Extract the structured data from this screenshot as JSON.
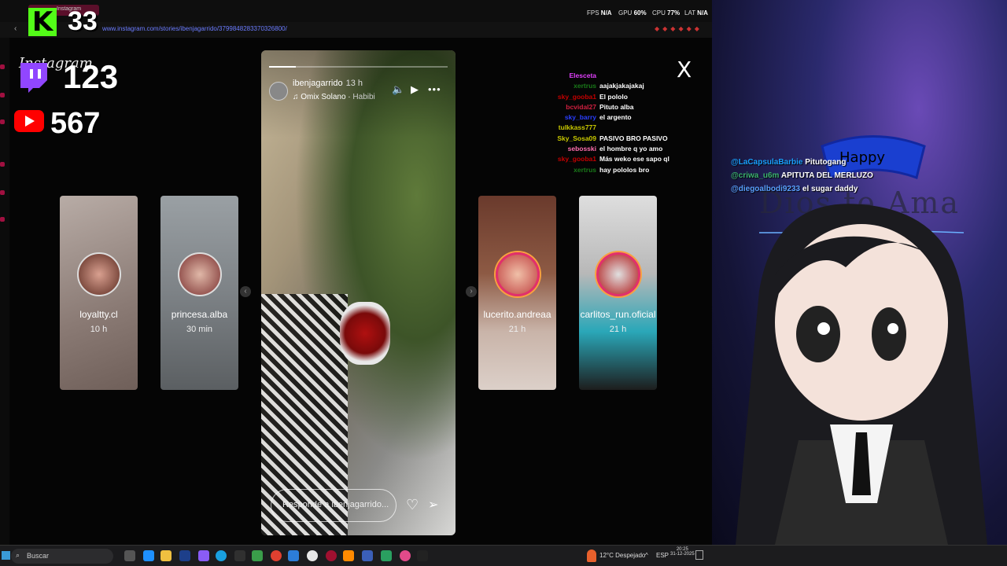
{
  "browser": {
    "tab_title": "Instagram",
    "url": "www.instagram.com/stories/ibenjagarrido/3799848283370326800/",
    "perf": {
      "fps_label": "FPS",
      "fps": "N/A",
      "gpu_label": "GPU",
      "gpu": "60%",
      "cpu_label": "CPU",
      "cpu": "77%",
      "lat_label": "LAT",
      "lat": "N/A"
    }
  },
  "overlay": {
    "kick_count": "33",
    "instagram_label": "Instagram",
    "twitch_count": "123",
    "youtube_count": "567"
  },
  "stories": {
    "left": [
      {
        "name": "loyaltty.cl",
        "time": "10 h"
      },
      {
        "name": "princesa.alba",
        "time": "30 min"
      }
    ],
    "right": [
      {
        "name": "lucerito.andreaa",
        "time": "21 h"
      },
      {
        "name": "carlitos_run.oficial",
        "time": "21 h"
      }
    ],
    "main": {
      "username": "ibenjagarrido",
      "time": "13 h",
      "music_artist": "Omix Solano",
      "music_title": "Habibi",
      "reply_placeholder": "Responde a ibenjagarrido...",
      "progress": 0.15
    }
  },
  "chat": [
    {
      "user": "Elesceta",
      "msg": "",
      "color": "#e040fb"
    },
    {
      "user": "xertrus",
      "msg": "aajakjakajakaj",
      "color": "#1a7a1a"
    },
    {
      "user": "sky_gooba1",
      "msg": "El pololo",
      "color": "#c40000"
    },
    {
      "user": "bcvidal27",
      "msg": "Pituto alba",
      "color": "#d02040"
    },
    {
      "user": "sky_barry",
      "msg": "el argento",
      "color": "#2a3fff"
    },
    {
      "user": "tulkkass777",
      "msg": "",
      "color": "#c9c900"
    },
    {
      "user": "Sky_Sosa09",
      "msg": "PASIVO BRO PASIVO",
      "color": "#c9c900"
    },
    {
      "user": "sebosski",
      "msg": "el hombre q yo amo",
      "color": "#ff6fae"
    },
    {
      "user": "sky_gooba1",
      "msg": "Más weko ese sapo ql",
      "color": "#c40000"
    },
    {
      "user": "xertrus",
      "msg": "hay pololos bro",
      "color": "#1a7a1a"
    }
  ],
  "stream_chat": [
    {
      "user": "@LaCapsulaBarbie",
      "msg": "Pitutogang",
      "color": "#1aa0ff"
    },
    {
      "user": "@criwa_u6m",
      "msg": "APITUTA DEL MERLUZO",
      "color": "#3cb371"
    },
    {
      "user": "@diegoalbodi9233",
      "msg": "el sugar daddy",
      "color": "#5aa0ff"
    }
  ],
  "stream_bg_text": {
    "happy": "Happy",
    "dios": "Dios te Ama"
  },
  "close_label": "X",
  "taskbar": {
    "search_placeholder": "Buscar",
    "weather": "12°C Despejado",
    "lang": "ESP",
    "time": "20:25",
    "date": "31-12-2025"
  },
  "colors": {
    "kick": "#53fc18",
    "twitch": "#9146ff",
    "youtube": "#ff0000"
  }
}
